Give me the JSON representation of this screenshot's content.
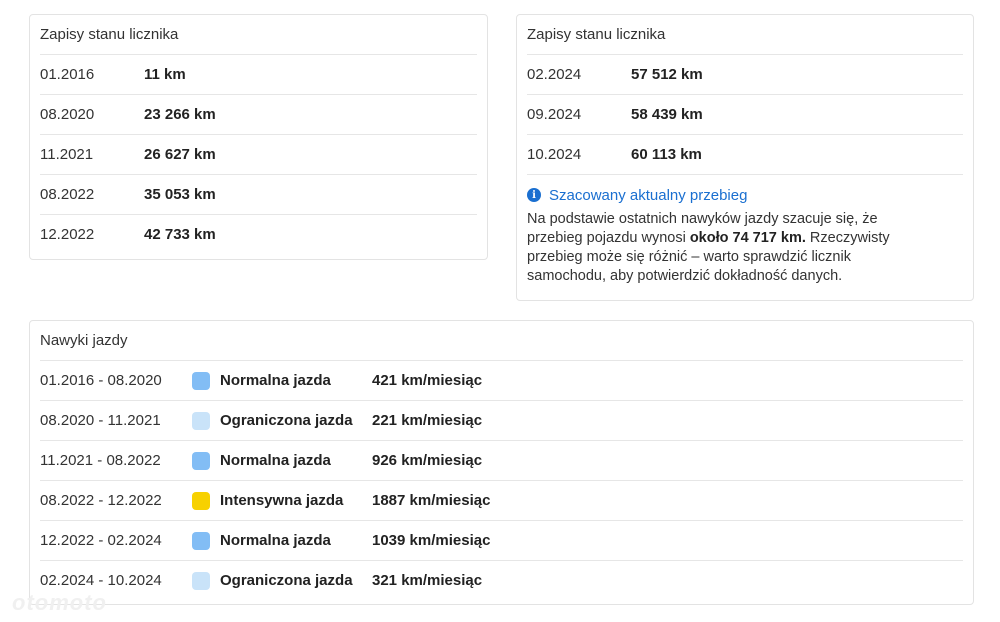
{
  "left_card": {
    "title": "Zapisy stanu licznika",
    "records": [
      {
        "date": "01.2016",
        "value": "11 km"
      },
      {
        "date": "08.2020",
        "value": "23 266 km"
      },
      {
        "date": "11.2021",
        "value": "26 627 km"
      },
      {
        "date": "08.2022",
        "value": "35 053 km"
      },
      {
        "date": "12.2022",
        "value": "42 733 km"
      }
    ]
  },
  "right_card": {
    "title": "Zapisy stanu licznika",
    "records": [
      {
        "date": "02.2024",
        "value": "57 512 km"
      },
      {
        "date": "09.2024",
        "value": "58 439 km"
      },
      {
        "date": "10.2024",
        "value": "60 113 km"
      }
    ],
    "estimate": {
      "icon": "info-icon",
      "heading": "Szacowany aktualny przebieg",
      "text_before": "Na podstawie ostatnich nawyków jazdy szacuje się, że przebieg pojazdu wynosi ",
      "highlight": "około 74 717 km.",
      "text_after": " Rzeczywisty przebieg może się różnić – warto sprawdzić licznik samochodu, aby potwierdzić dokładność danych."
    }
  },
  "habits": {
    "title": "Nawyki jazdy",
    "rows": [
      {
        "period": "01.2016 - 08.2020",
        "type": "Normalna jazda",
        "rate": "421 km/miesiąc",
        "color": "#82bdf5"
      },
      {
        "period": "08.2020 - 11.2021",
        "type": "Ograniczona jazda",
        "rate": "221 km/miesiąc",
        "color": "#c9e3f9"
      },
      {
        "period": "11.2021 - 08.2022",
        "type": "Normalna jazda",
        "rate": "926 km/miesiąc",
        "color": "#82bdf5"
      },
      {
        "period": "08.2022 - 12.2022",
        "type": "Intensywna jazda",
        "rate": "1887 km/miesiąc",
        "color": "#f7d100"
      },
      {
        "period": "12.2022 - 02.2024",
        "type": "Normalna jazda",
        "rate": "1039 km/miesiąc",
        "color": "#82bdf5"
      },
      {
        "period": "02.2024 - 10.2024",
        "type": "Ograniczona jazda",
        "rate": "321 km/miesiąc",
        "color": "#c9e3f9"
      }
    ]
  },
  "colors": {
    "accent": "#1a6fd0",
    "border": "#e3e3e3"
  },
  "watermark": "otomoto"
}
